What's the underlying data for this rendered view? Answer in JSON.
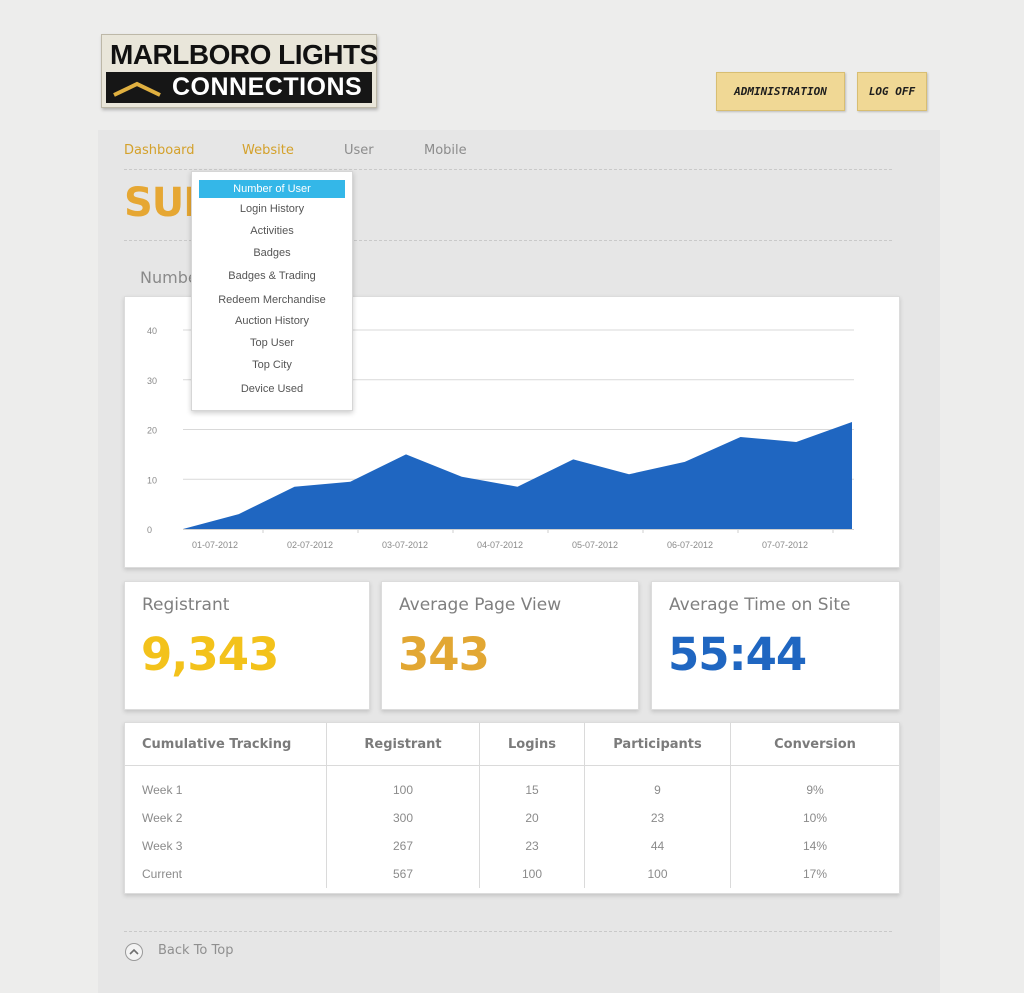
{
  "header": {
    "logo_line1": "MARLBORO LIGHTS",
    "logo_line2": "CONNECTIONS",
    "admin_label": "ADMINISTRATION",
    "logoff_label": "LOG OFF"
  },
  "nav": {
    "items": [
      {
        "label": "Dashboard",
        "active": true
      },
      {
        "label": "Website",
        "active": true
      },
      {
        "label": "User",
        "active": false
      },
      {
        "label": "Mobile",
        "active": false
      }
    ],
    "dropdown": [
      "Number of User",
      "Login History",
      "Activities",
      "Badges",
      "Badges & Trading",
      "Redeem Merchandise",
      "Auction History",
      "Top User",
      "Top City",
      "Device Used"
    ],
    "dropdown_selected": "Number of User"
  },
  "page": {
    "title_visible": "SUM",
    "subtitle_visible": "Number"
  },
  "chart_data": {
    "type": "area",
    "x": [
      "01-07-2012",
      "",
      "02-07-2012",
      "",
      "03-07-2012",
      "",
      "04-07-2012",
      "",
      "05-07-2012",
      "",
      "06-07-2012",
      "",
      "07-07-2012",
      "",
      ""
    ],
    "x_tick_labels": [
      "01-07-2012",
      "02-07-2012",
      "03-07-2012",
      "04-07-2012",
      "05-07-2012",
      "06-07-2012",
      "07-07-2012"
    ],
    "values": [
      0,
      3,
      8.5,
      9.5,
      15,
      10.5,
      8.5,
      14,
      11,
      13.5,
      18.5,
      17.5,
      21.5
    ],
    "ylim": [
      0,
      40
    ],
    "y_ticks": [
      0,
      10,
      20,
      30,
      40
    ],
    "grid": true,
    "color": "#1f66c1"
  },
  "stats": {
    "registrant": {
      "label": "Registrant",
      "value": "9,343",
      "color": "#f3c21b"
    },
    "avg_page_view": {
      "label": "Average Page View",
      "value": "343",
      "color": "#e2a733"
    },
    "avg_time": {
      "label": "Average Time on Site",
      "value": "55:44",
      "color": "#1f66c1"
    }
  },
  "table": {
    "headers": [
      "Cumulative Tracking",
      "Registrant",
      "Logins",
      "Participants",
      "Conversion"
    ],
    "rows": [
      [
        "Week 1",
        "100",
        "15",
        "9",
        "9%"
      ],
      [
        "Week 2",
        "300",
        "20",
        "23",
        "10%"
      ],
      [
        "Week 3",
        "267",
        "23",
        "44",
        "14%"
      ],
      [
        "Current",
        "567",
        "100",
        "100",
        "17%"
      ]
    ]
  },
  "footer": {
    "back_to_top": "Back To Top"
  }
}
